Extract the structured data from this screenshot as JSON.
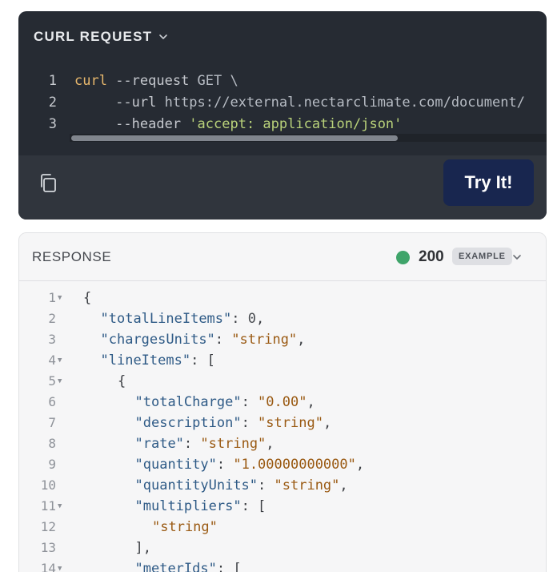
{
  "curl": {
    "title": "CURL REQUEST",
    "lines": [
      {
        "num": "1",
        "parts": [
          {
            "t": "curl",
            "c": "c-cmd"
          },
          {
            "t": " --request ",
            "c": "c-flag"
          },
          {
            "t": "GET \\",
            "c": "c-plain"
          }
        ]
      },
      {
        "num": "2",
        "parts": [
          {
            "t": "     --url ",
            "c": "c-flag"
          },
          {
            "t": "https://external.nectarclimate.com/document/",
            "c": "c-plain"
          }
        ]
      },
      {
        "num": "3",
        "parts": [
          {
            "t": "     --header ",
            "c": "c-flag"
          },
          {
            "t": "'accept: application/json'",
            "c": "c-str"
          }
        ]
      }
    ],
    "try_label": "Try It!",
    "copy_icon": "copy-icon"
  },
  "response": {
    "title": "RESPONSE",
    "status_code": "200",
    "badge": "EXAMPLE",
    "status_color": "#3fa46a",
    "lines": [
      {
        "num": "1",
        "fold": true,
        "indent": 0,
        "parts": [
          {
            "t": "{",
            "c": "j-punc"
          }
        ]
      },
      {
        "num": "2",
        "fold": false,
        "indent": 1,
        "parts": [
          {
            "t": "\"totalLineItems\"",
            "c": "j-key"
          },
          {
            "t": ": ",
            "c": "j-punc"
          },
          {
            "t": "0",
            "c": "j-num"
          },
          {
            "t": ",",
            "c": "j-punc"
          }
        ]
      },
      {
        "num": "3",
        "fold": false,
        "indent": 1,
        "parts": [
          {
            "t": "\"chargesUnits\"",
            "c": "j-key"
          },
          {
            "t": ": ",
            "c": "j-punc"
          },
          {
            "t": "\"string\"",
            "c": "j-str"
          },
          {
            "t": ",",
            "c": "j-punc"
          }
        ]
      },
      {
        "num": "4",
        "fold": true,
        "indent": 1,
        "parts": [
          {
            "t": "\"lineItems\"",
            "c": "j-key"
          },
          {
            "t": ": [",
            "c": "j-punc"
          }
        ]
      },
      {
        "num": "5",
        "fold": true,
        "indent": 2,
        "parts": [
          {
            "t": "{",
            "c": "j-punc"
          }
        ]
      },
      {
        "num": "6",
        "fold": false,
        "indent": 3,
        "parts": [
          {
            "t": "\"totalCharge\"",
            "c": "j-key"
          },
          {
            "t": ": ",
            "c": "j-punc"
          },
          {
            "t": "\"0.00\"",
            "c": "j-str"
          },
          {
            "t": ",",
            "c": "j-punc"
          }
        ]
      },
      {
        "num": "7",
        "fold": false,
        "indent": 3,
        "parts": [
          {
            "t": "\"description\"",
            "c": "j-key"
          },
          {
            "t": ": ",
            "c": "j-punc"
          },
          {
            "t": "\"string\"",
            "c": "j-str"
          },
          {
            "t": ",",
            "c": "j-punc"
          }
        ]
      },
      {
        "num": "8",
        "fold": false,
        "indent": 3,
        "parts": [
          {
            "t": "\"rate\"",
            "c": "j-key"
          },
          {
            "t": ": ",
            "c": "j-punc"
          },
          {
            "t": "\"string\"",
            "c": "j-str"
          },
          {
            "t": ",",
            "c": "j-punc"
          }
        ]
      },
      {
        "num": "9",
        "fold": false,
        "indent": 3,
        "parts": [
          {
            "t": "\"quantity\"",
            "c": "j-key"
          },
          {
            "t": ": ",
            "c": "j-punc"
          },
          {
            "t": "\"1.00000000000\"",
            "c": "j-str"
          },
          {
            "t": ",",
            "c": "j-punc"
          }
        ]
      },
      {
        "num": "10",
        "fold": false,
        "indent": 3,
        "parts": [
          {
            "t": "\"quantityUnits\"",
            "c": "j-key"
          },
          {
            "t": ": ",
            "c": "j-punc"
          },
          {
            "t": "\"string\"",
            "c": "j-str"
          },
          {
            "t": ",",
            "c": "j-punc"
          }
        ]
      },
      {
        "num": "11",
        "fold": true,
        "indent": 3,
        "parts": [
          {
            "t": "\"multipliers\"",
            "c": "j-key"
          },
          {
            "t": ": [",
            "c": "j-punc"
          }
        ]
      },
      {
        "num": "12",
        "fold": false,
        "indent": 4,
        "parts": [
          {
            "t": "\"string\"",
            "c": "j-str"
          }
        ]
      },
      {
        "num": "13",
        "fold": false,
        "indent": 3,
        "parts": [
          {
            "t": "],",
            "c": "j-punc"
          }
        ]
      },
      {
        "num": "14",
        "fold": true,
        "indent": 3,
        "parts": [
          {
            "t": "\"meterIds\"",
            "c": "j-key"
          },
          {
            "t": ": [",
            "c": "j-punc"
          }
        ]
      }
    ]
  }
}
